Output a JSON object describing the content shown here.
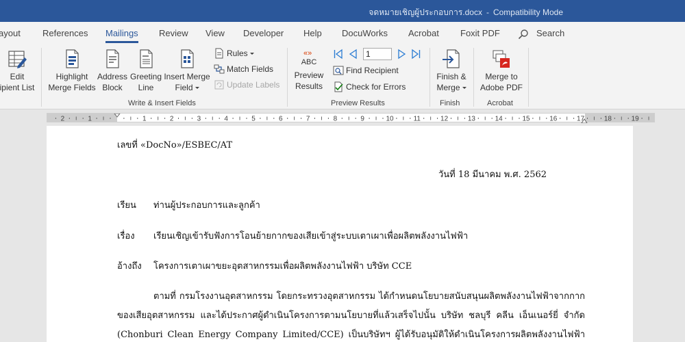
{
  "window": {
    "title": "จดหมายเชิญผู้ประกอบการ.docx",
    "separator": "-",
    "mode": "Compatibility Mode"
  },
  "tabs": [
    {
      "label": "ayout"
    },
    {
      "label": "References"
    },
    {
      "label": "Mailings",
      "active": true
    },
    {
      "label": "Review"
    },
    {
      "label": "View"
    },
    {
      "label": "Developer"
    },
    {
      "label": "Help"
    },
    {
      "label": "DocuWorks"
    },
    {
      "label": "Acrobat"
    },
    {
      "label": "Foxit PDF"
    }
  ],
  "search": {
    "label": "Search",
    "icon": "search-icon"
  },
  "ribbon": {
    "edit_list": {
      "line1": "Edit",
      "line2": "ipient List"
    },
    "highlight": {
      "line1": "Highlight",
      "line2": "Merge Fields"
    },
    "address": {
      "line1": "Address",
      "line2": "Block"
    },
    "greeting": {
      "line1": "Greeting",
      "line2": "Line"
    },
    "insert_merge": {
      "line1": "Insert Merge",
      "line2": "Field"
    },
    "rules": "Rules",
    "match_fields": "Match Fields",
    "update_labels": "Update Labels",
    "group_write_insert": "Write & Insert Fields",
    "preview": {
      "abc": "ABC",
      "line1": "Preview",
      "line2": "Results"
    },
    "record_value": "1",
    "find_recipient": "Find Recipient",
    "check_errors": "Check for Errors",
    "group_preview": "Preview Results",
    "finish": {
      "line1": "Finish &",
      "line2": "Merge"
    },
    "group_finish": "Finish",
    "merge_pdf": {
      "line1": "Merge to",
      "line2": "Adobe PDF"
    },
    "group_acrobat": "Acrobat"
  },
  "ruler": {
    "left_numbers": [
      "2",
      "1"
    ],
    "right_numbers": [
      "1",
      "2",
      "3",
      "4",
      "5",
      "6",
      "7",
      "8",
      "9",
      "10",
      "11",
      "12",
      "13",
      "14",
      "15",
      "16",
      "17",
      "18",
      "19"
    ]
  },
  "document": {
    "ref_number": "เลขที่ «DocNo»/ESBEC/AT",
    "date": "วันที่ 18  มีนาคม พ.ศ. 2562",
    "to_label": "เรียน",
    "to_text": "ท่านผู้ประกอบการและลูกค้า",
    "subject_label": "เรื่อง",
    "subject_text": "เรียนเชิญเข้ารับฟังการโอนย้ายกากของเสียเข้าสู่ระบบเตาเผาเพื่อผลิตพลังงานไฟฟ้า",
    "reference_label": "อ้างถึง",
    "reference_text": "โครงการเตาเผาขยะอุตสาหกรรมเพื่อผลิตพลังงานไฟฟ้า บริษัท CCE",
    "body_line1": "ตามที่  กรมโรงงานอุตสาหกรรม  โดยกระทรวงอุตสาหกรรม  ได้กำหนดนโยบายสนับสนุนผลิตพลังงานไฟฟ้าจากกาก",
    "body_line2": "ของเสียอุตสาหกรรม  และได้ประกาศผู้ดำเนินโครงการตามนโยบายที่แล้วเสร็จไปนั้น  บริษัท  ชลบุรี  คลีน  เอ็นเนอร์ยี่  จำกัด",
    "body_line3": "(Chonburi  Clean  Energy  Company  Limited/CCE)   เป็นบริษัทฯ  ผู้ได้รับอนุมัติให้ดำเนินโครงการผลิตพลังงานไฟฟ้าจากขยะ"
  }
}
